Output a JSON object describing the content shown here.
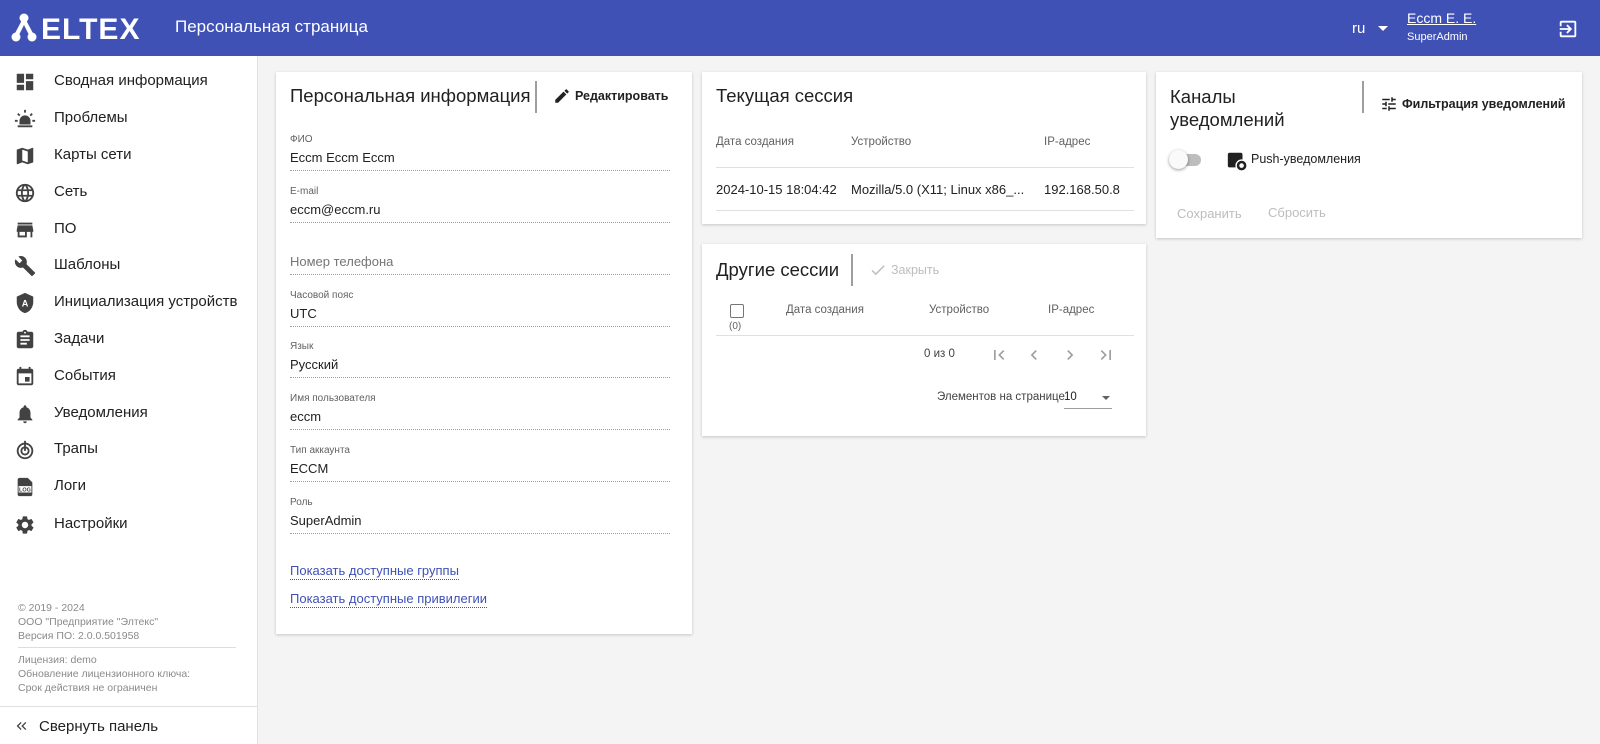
{
  "header": {
    "logo_text": "ELTEX",
    "title": "Персональная страница",
    "lang": "ru",
    "user_name": "Eccm E. E.",
    "user_role": "SuperAdmin",
    "colors": {
      "primary": "#3f51b5"
    }
  },
  "sidebar": {
    "items": [
      {
        "label": "Сводная информация",
        "icon": "dashboard-icon"
      },
      {
        "label": "Проблемы",
        "icon": "alarm-light-icon"
      },
      {
        "label": "Карты сети",
        "icon": "map-icon"
      },
      {
        "label": "Сеть",
        "icon": "globe-icon"
      },
      {
        "label": "ПО",
        "icon": "store-icon"
      },
      {
        "label": "Шаблоны",
        "icon": "wrench-icon"
      },
      {
        "label": "Инициализация устройств",
        "icon": "auto-icon"
      },
      {
        "label": "Задачи",
        "icon": "clipboard-icon"
      },
      {
        "label": "События",
        "icon": "calendar-icon"
      },
      {
        "label": "Уведомления",
        "icon": "bell-icon"
      },
      {
        "label": "Трапы",
        "icon": "trap-icon"
      },
      {
        "label": "Логи",
        "icon": "log-icon"
      },
      {
        "label": "Настройки",
        "icon": "gear-icon"
      }
    ],
    "footer": {
      "copyright": "© 2019 - 2024",
      "company": "ООО \"Предприятие \"Элтекс\"",
      "version": "Версия ПО: 2.0.0.501958",
      "license": "Лицензия: demo",
      "license_update": "Обновление лицензионного ключа:",
      "license_term": "Срок действия не ограничен"
    },
    "collapse_label": "Свернуть панель"
  },
  "personal": {
    "title": "Персональная информация",
    "edit_label": "Редактировать",
    "fields": [
      {
        "label": "ФИО",
        "value": "Eccm Eccm Eccm"
      },
      {
        "label": "E-mail",
        "value": "eccm@eccm.ru"
      },
      {
        "label": "",
        "placeholder": "Номер телефона"
      },
      {
        "label": "Часовой пояс",
        "value": "UTC"
      },
      {
        "label": "Язык",
        "value": "Русский"
      },
      {
        "label": "Имя пользователя",
        "value": "eccm"
      },
      {
        "label": "Тип аккаунта",
        "value": "ECCM"
      },
      {
        "label": "Роль",
        "value": "SuperAdmin"
      }
    ],
    "link_groups": "Показать доступные группы",
    "link_privileges": "Показать доступные привилегии"
  },
  "current_session": {
    "title": "Текущая сессия",
    "columns": [
      "Дата создания",
      "Устройство",
      "IP-адрес"
    ],
    "row": [
      "2024-10-15 18:04:42",
      "Mozilla/5.0 (X11; Linux x86_...",
      "192.168.50.8"
    ]
  },
  "other_sessions": {
    "title": "Другие сессии",
    "close_label": "Закрыть",
    "select_count": "(0)",
    "columns": [
      "Дата создания",
      "Устройство",
      "IP-адрес"
    ],
    "range": "0 из 0",
    "per_page_label": "Элементов на странице",
    "per_page_value": "10"
  },
  "channels": {
    "title_line1": "Каналы",
    "title_line2": "уведомлений",
    "filter_label": "Фильтрация уведомлений",
    "push_label": "Push-уведомления",
    "push_enabled": false,
    "save_label": "Сохранить",
    "reset_label": "Сбросить"
  }
}
